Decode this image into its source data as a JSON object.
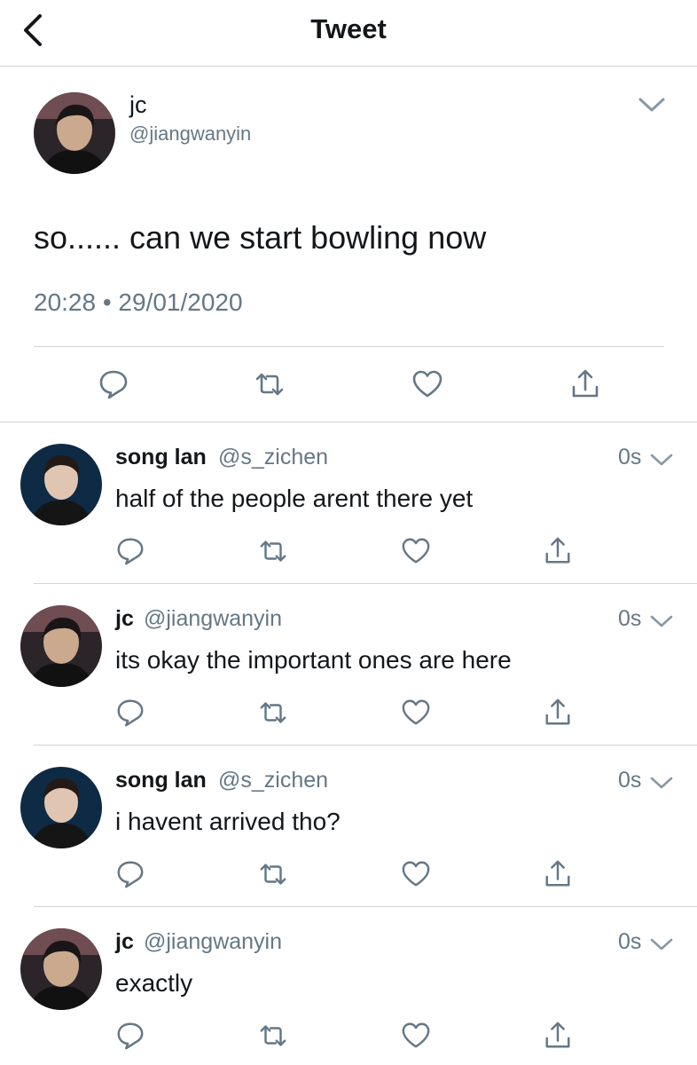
{
  "header": {
    "title": "Tweet"
  },
  "main_tweet": {
    "name": "jc",
    "handle": "@jiangwanyin",
    "text": "so...... can we start bowling now",
    "timestamp": "20:28 • 29/01/2020"
  },
  "replies": [
    {
      "name": "song lan",
      "handle": "@s_zichen",
      "time": "0s",
      "text": "half of the people arent there yet"
    },
    {
      "name": "jc",
      "handle": "@jiangwanyin",
      "time": "0s",
      "text": "its okay the important ones are here"
    },
    {
      "name": "song lan",
      "handle": "@s_zichen",
      "time": "0s",
      "text": "i havent arrived tho?"
    },
    {
      "name": "jc",
      "handle": "@jiangwanyin",
      "time": "0s",
      "text": "exactly"
    }
  ],
  "icons": [
    "back-icon",
    "chevron-down-icon",
    "reply-icon",
    "retweet-icon",
    "like-icon",
    "share-icon"
  ],
  "colors": {
    "text": "#14171a",
    "secondary": "#657786",
    "divider": "#cfd4d9"
  }
}
